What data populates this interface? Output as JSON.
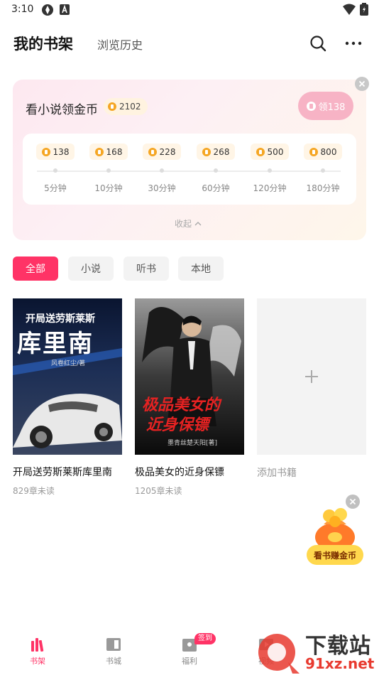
{
  "status_bar": {
    "time": "3:10"
  },
  "header": {
    "title": "我的书架",
    "history_tab": "浏览历史"
  },
  "reward_card": {
    "title": "看小说领金币",
    "coin_balance": "2102",
    "claim_label": "领138",
    "milestones": [
      {
        "coins": "138",
        "duration": "5分钟"
      },
      {
        "coins": "168",
        "duration": "10分钟"
      },
      {
        "coins": "228",
        "duration": "30分钟"
      },
      {
        "coins": "268",
        "duration": "60分钟"
      },
      {
        "coins": "500",
        "duration": "120分钟"
      },
      {
        "coins": "800",
        "duration": "180分钟"
      }
    ],
    "collapse_label": "收起"
  },
  "filters": [
    "全部",
    "小说",
    "听书",
    "本地"
  ],
  "books": [
    {
      "title": "开局送劳斯莱斯库里南",
      "progress": "829章未读",
      "cover_text": [
        "开局送劳斯莱斯",
        "库里南",
        "风卷红尘/著"
      ]
    },
    {
      "title": "极品美女的近身保镖",
      "progress": "1205章未读",
      "cover_text": [
        "极品美女的",
        "近身保镖",
        "墨青丝楚天阳[著]"
      ]
    }
  ],
  "add_book_label": "添加书籍",
  "floating_reward": {
    "label": "看书赚金币"
  },
  "bottom_nav": [
    {
      "label": "书架"
    },
    {
      "label": "书城"
    },
    {
      "label": "福利",
      "badge": "签到"
    },
    {
      "label": "视频"
    }
  ],
  "watermark": {
    "line1": "下载站",
    "line2": "91xz.net"
  },
  "colors": {
    "accent": "#ff3366",
    "coin": "#f5a623"
  }
}
